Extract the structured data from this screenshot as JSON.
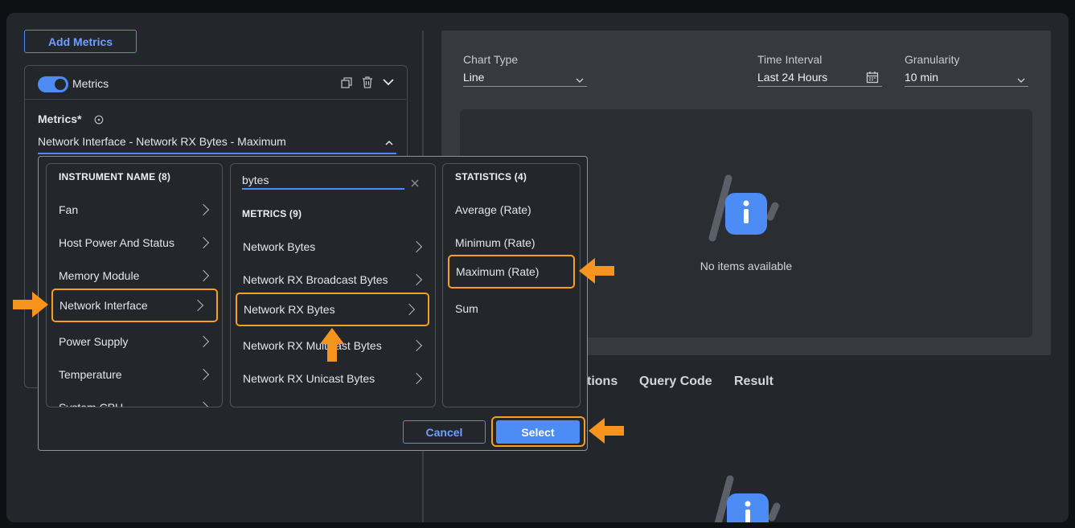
{
  "left": {
    "add_metrics_label": "Add Metrics",
    "toggle_label": "Metrics",
    "metrics_label": "Metrics*",
    "metrics_value": "Network Interface - Network RX Bytes - Maximum"
  },
  "chart_settings": {
    "chart_type_label": "Chart Type",
    "chart_type_value": "Line",
    "time_interval_label": "Time Interval",
    "time_interval_value": "Last 24 Hours",
    "granularity_label": "Granularity",
    "granularity_value": "10 min",
    "empty_text": "No items available"
  },
  "tabs": [
    "tions",
    "Query Code",
    "Result"
  ],
  "picker": {
    "instrument_header": "INSTRUMENT NAME (8)",
    "instruments": [
      "Fan",
      "Host Power And Status",
      "Memory Module",
      "Network Interface",
      "Power Supply",
      "Temperature",
      "System CPU"
    ],
    "search_value": "bytes",
    "metrics_header": "METRICS (9)",
    "metrics": [
      "Network Bytes",
      "Network RX Broadcast Bytes",
      "Network RX Bytes",
      "Network RX Multicast Bytes",
      "Network RX Unicast Bytes"
    ],
    "statistics_header": "STATISTICS (4)",
    "statistics": [
      "Average (Rate)",
      "Minimum (Rate)",
      "Maximum (Rate)",
      "Sum"
    ],
    "cancel_label": "Cancel",
    "select_label": "Select"
  },
  "colors": {
    "accent": "#4d8cf5",
    "highlight": "#f5a021",
    "arrow": "#f7941d"
  }
}
